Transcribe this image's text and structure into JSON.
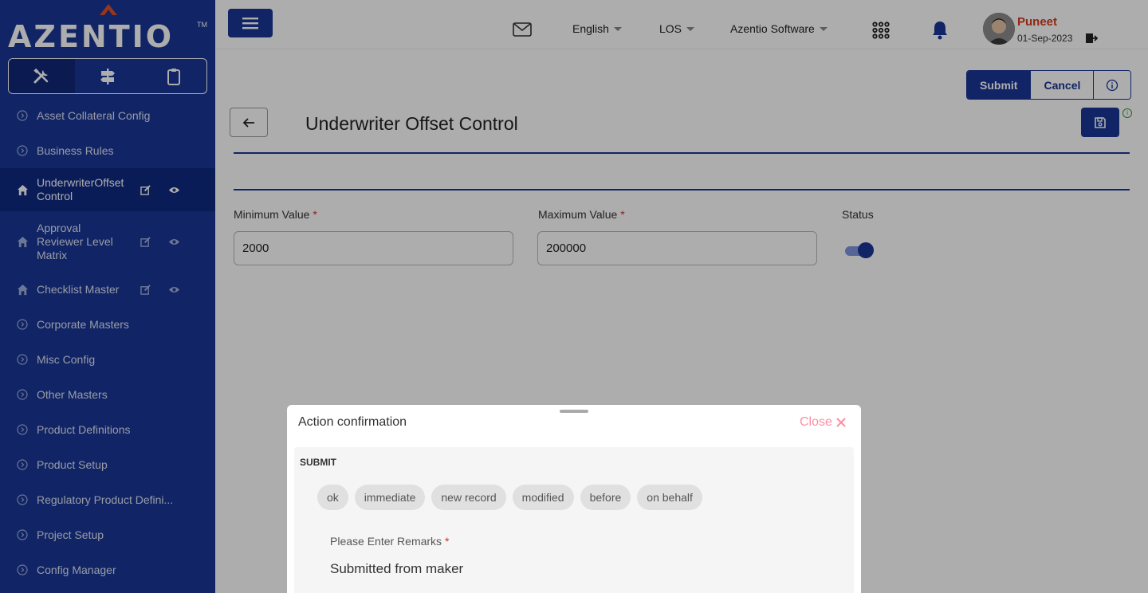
{
  "brand": {
    "name": "AZENTIO",
    "tm": "TM"
  },
  "sidebar": {
    "modes": [
      {
        "icon": "tools-icon"
      },
      {
        "icon": "signpost-icon"
      },
      {
        "icon": "clipboard-icon"
      }
    ],
    "items": [
      {
        "label": "Asset Collateral Config",
        "type": "group"
      },
      {
        "label": "Business Rules",
        "type": "group"
      },
      {
        "label": "UnderwriterOffsetControl",
        "type": "page",
        "active": true
      },
      {
        "label": "Approval Reviewer Level Matrix",
        "type": "page"
      },
      {
        "label": "Checklist Master",
        "type": "page"
      },
      {
        "label": "Corporate Masters",
        "type": "group"
      },
      {
        "label": "Misc Config",
        "type": "group"
      },
      {
        "label": "Other Masters",
        "type": "group"
      },
      {
        "label": "Product Definitions",
        "type": "group"
      },
      {
        "label": "Product Setup",
        "type": "group"
      },
      {
        "label": "Regulatory Product Defini...",
        "type": "group"
      },
      {
        "label": "Project Setup",
        "type": "group"
      },
      {
        "label": "Config Manager",
        "type": "group"
      }
    ]
  },
  "topbar": {
    "language": "English",
    "module": "LOS",
    "company": "Azentio Software",
    "user": {
      "name": "Puneet",
      "date": "01-Sep-2023"
    }
  },
  "actions": {
    "submit": "Submit",
    "cancel": "Cancel"
  },
  "page": {
    "title": "Underwriter Offset Control",
    "fields": {
      "min_label": "Minimum Value",
      "min_value": "2000",
      "max_label": "Maximum Value",
      "max_value": "200000",
      "status_label": "Status",
      "status_on": true,
      "required_mark": "*"
    }
  },
  "dialog": {
    "title": "Action confirmation",
    "close_label": "Close",
    "section": "SUBMIT",
    "chips": [
      "ok",
      "immediate",
      "new record",
      "modified",
      "before",
      "on behalf"
    ],
    "remarks_label": "Please Enter Remarks",
    "remarks_value": "Submitted from maker"
  },
  "colors": {
    "primary": "#1a3596",
    "danger": "#d0312d",
    "user_name": "#d53a1d"
  }
}
